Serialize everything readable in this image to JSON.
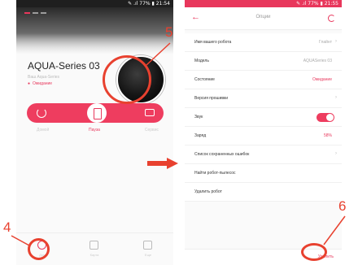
{
  "left_screen": {
    "status_text": "✎ .ıl 77% ▮ 21:54",
    "robot": {
      "name": "AQUA-Series 03",
      "subtitle": "Ваш Aqua-Series",
      "status": "Ожидание"
    },
    "controls": {
      "left_label": "Домой",
      "center_label": "Пауза",
      "right_label": "Сервис"
    },
    "nav": {
      "item1": "Дом",
      "item2": "Карта",
      "item3": "Еще"
    }
  },
  "right_screen": {
    "status_text": "✎ .ıl 77% ▮ 21:55",
    "title": "Опции",
    "rows": [
      {
        "label": "Имя вашего робота",
        "value": "Глайнт"
      },
      {
        "label": "Модель",
        "value": "AQUASeries 03"
      },
      {
        "label": "Состояние",
        "value": "Ожидание"
      },
      {
        "label": "Версия прошивки",
        "value": ""
      },
      {
        "label": "Звук",
        "value": ""
      },
      {
        "label": "Заряд",
        "value": "58%"
      },
      {
        "label": "Список сохраненных ошибок",
        "value": ""
      },
      {
        "label": "Найти робот-пылесос",
        "value": ""
      },
      {
        "label": "Удалить робот",
        "value": ""
      }
    ],
    "sound_on": true,
    "bottom_action": "Удалить"
  },
  "callouts": {
    "n4": "4",
    "n5": "5",
    "n6": "6"
  },
  "colors": {
    "accent": "#e8375c",
    "annotation": "#e8412f"
  }
}
